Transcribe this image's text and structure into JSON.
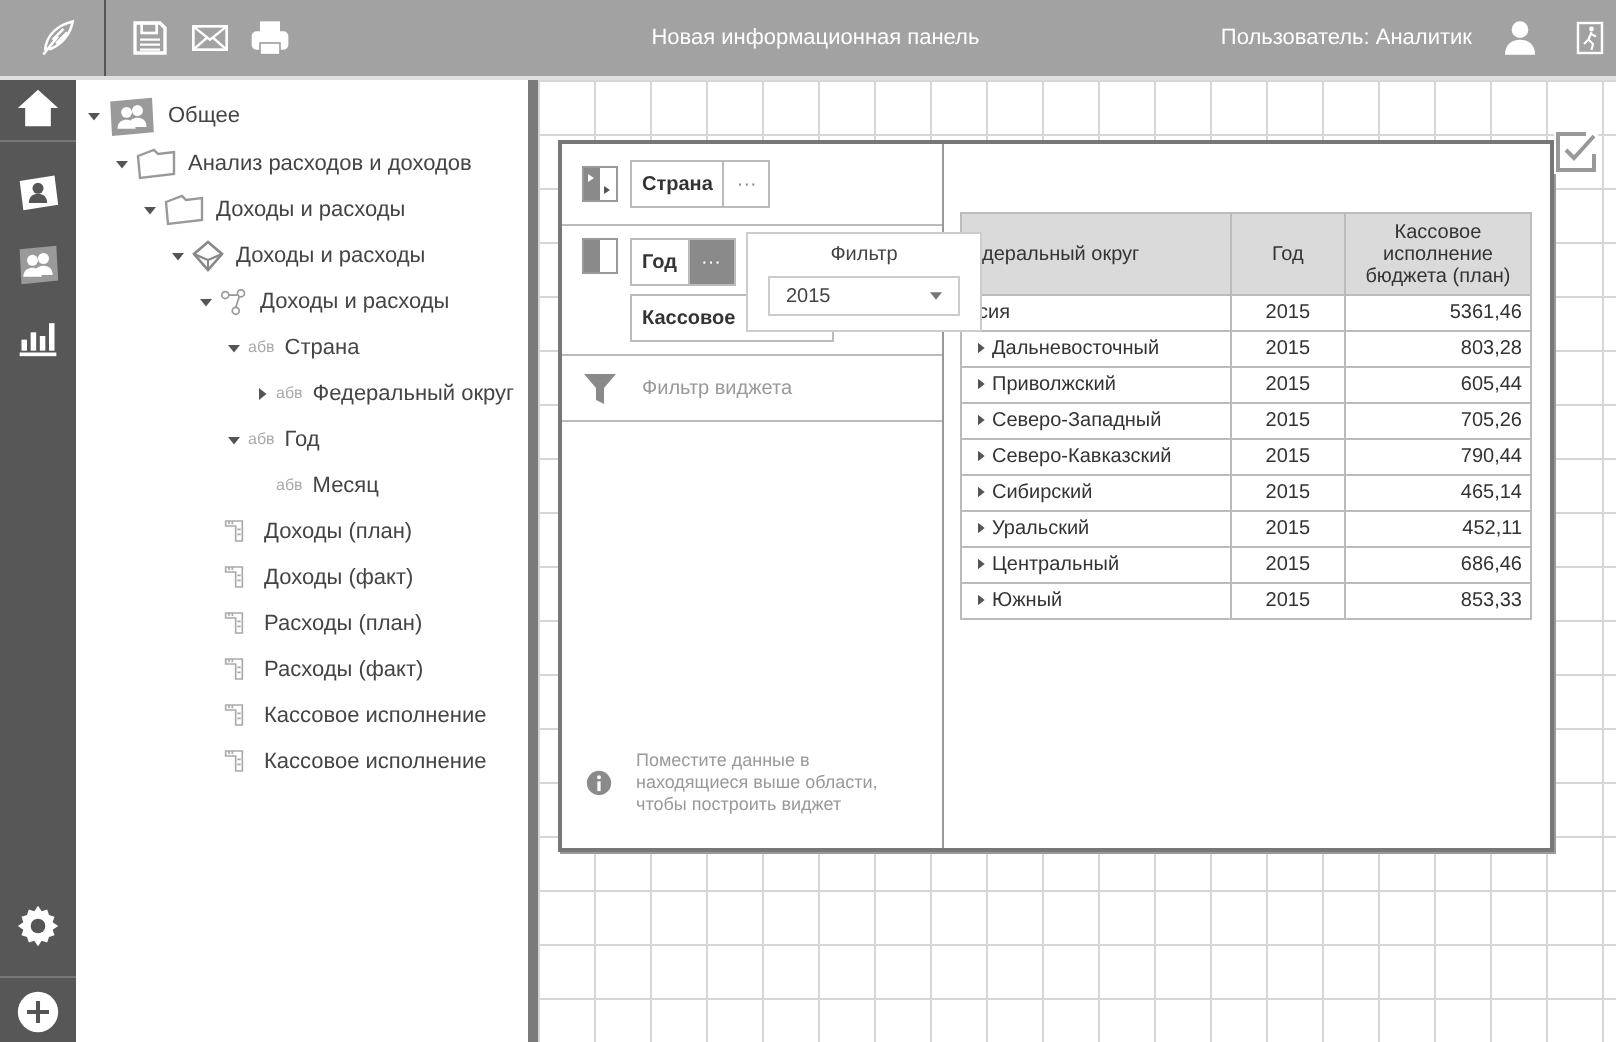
{
  "top_bar": {
    "title": "Новая информационная панель",
    "user": "Пользователь: Аналитик"
  },
  "tree": [
    {
      "kind": "group",
      "label": "Общее",
      "expanded": true,
      "children": [
        {
          "kind": "folder",
          "label": "Анализ расходов и доходов",
          "expanded": true,
          "children": [
            {
              "kind": "folder",
              "label": "Доходы и расходы",
              "expanded": true,
              "children": [
                {
                  "kind": "cube",
                  "label": "Доходы и расходы",
                  "expanded": true,
                  "children": [
                    {
                      "kind": "hierarchy",
                      "label": "Доходы и расходы",
                      "expanded": true,
                      "children": [
                        {
                          "kind": "attribute",
                          "badge": "абв",
                          "label": "Страна",
                          "expanded": true,
                          "children": [
                            {
                              "kind": "attribute",
                              "badge": "абв",
                              "label": "Федеральный округ",
                              "expanded": false
                            }
                          ]
                        },
                        {
                          "kind": "attribute",
                          "badge": "абв",
                          "label": "Год",
                          "expanded": true,
                          "children": [
                            {
                              "kind": "attribute",
                              "badge": "абв",
                              "label": "Месяц"
                            }
                          ]
                        },
                        {
                          "kind": "measure",
                          "label": "Доходы (план)"
                        },
                        {
                          "kind": "measure",
                          "label": "Доходы (факт)"
                        },
                        {
                          "kind": "measure",
                          "label": "Расходы (план)"
                        },
                        {
                          "kind": "measure",
                          "label": "Расходы (факт)"
                        },
                        {
                          "kind": "measure",
                          "label": "Кассовое исполнение"
                        },
                        {
                          "kind": "measure",
                          "label": "Кассовое исполнение"
                        }
                      ]
                    }
                  ]
                }
              ]
            }
          ]
        }
      ]
    }
  ],
  "widget_config": {
    "rows_field": {
      "chips": [
        {
          "label": "Страна",
          "menu": "···",
          "selected": false
        }
      ]
    },
    "columns_field": {
      "chips": [
        {
          "label": "Год",
          "menu": "···",
          "selected": true
        },
        {
          "label": "Кассовое"
        }
      ]
    },
    "filter_label": "Фильтр виджета",
    "hint": "Поместите данные в находящиеся выше области, чтобы построить виджет"
  },
  "filter_popup": {
    "title": "Фильтр",
    "value": "2015"
  },
  "table": {
    "columns": [
      "деральный округ",
      "Год",
      "Кассовое исполнение бюджета (план)"
    ],
    "total_row": [
      "сия",
      "2015",
      "5361,46"
    ],
    "rows": [
      {
        "cells": [
          "Дальневосточный",
          "2015",
          "803,28"
        ],
        "expanded": false
      },
      {
        "cells": [
          "Приволжский",
          "2015",
          "605,44"
        ],
        "expanded": false
      },
      {
        "cells": [
          "Северо-Западный",
          "2015",
          "705,26"
        ],
        "expanded": false
      },
      {
        "cells": [
          "Северо-Кавказский",
          "2015",
          "790,44"
        ],
        "expanded": false
      },
      {
        "cells": [
          "Сибирский",
          "2015",
          "465,14"
        ],
        "expanded": false
      },
      {
        "cells": [
          "Уральский",
          "2015",
          "452,11"
        ],
        "expanded": false
      },
      {
        "cells": [
          "Центральный",
          "2015",
          "686,46"
        ],
        "expanded": false
      },
      {
        "cells": [
          "Южный",
          "2015",
          "853,33"
        ],
        "expanded": false
      }
    ]
  }
}
